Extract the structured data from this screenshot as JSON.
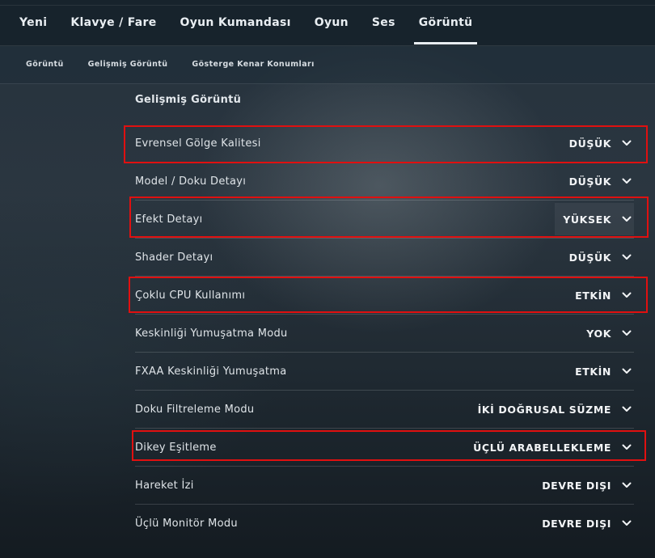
{
  "top_tabs": [
    {
      "label": "Yeni"
    },
    {
      "label": "Klavye / Fare"
    },
    {
      "label": "Oyun Kumandası"
    },
    {
      "label": "Oyun"
    },
    {
      "label": "Ses"
    },
    {
      "label": "Görüntü",
      "active": true
    }
  ],
  "sub_tabs": [
    {
      "label": "Görüntü"
    },
    {
      "label": "Gelişmiş Görüntü"
    },
    {
      "label": "Gösterge Kenar Konumları"
    }
  ],
  "section_title": "Gelişmiş Görüntü",
  "settings": [
    {
      "label": "Evrensel Gölge Kalitesi",
      "value": "DÜŞÜK",
      "highlighted": true
    },
    {
      "label": "Model / Doku Detayı",
      "value": "DÜŞÜK",
      "highlighted": false
    },
    {
      "label": "Efekt Detayı",
      "value": "YÜKSEK",
      "highlighted": true
    },
    {
      "label": "Shader Detayı",
      "value": "DÜŞÜK",
      "highlighted": false
    },
    {
      "label": "Çoklu CPU Kullanımı",
      "value": "ETKİN",
      "highlighted": true
    },
    {
      "label": "Keskinliği Yumuşatma Modu",
      "value": "YOK",
      "highlighted": false
    },
    {
      "label": "FXAA Keskinliği Yumuşatma",
      "value": "ETKİN",
      "highlighted": false
    },
    {
      "label": "Doku Filtreleme Modu",
      "value": "İKİ DOĞRUSAL SÜZME",
      "highlighted": false
    },
    {
      "label": "Dikey Eşitleme",
      "value": "ÜÇLÜ ARABELLEKLEME",
      "highlighted": true
    },
    {
      "label": "Hareket İzi",
      "value": "DEVRE DIŞI",
      "highlighted": false
    },
    {
      "label": "Üçlü Monitör Modu",
      "value": "DEVRE DIŞI",
      "highlighted": false
    }
  ],
  "icons": {
    "dropdown": "chevron-down-icon"
  },
  "colors": {
    "highlight_border": "#e01010"
  }
}
